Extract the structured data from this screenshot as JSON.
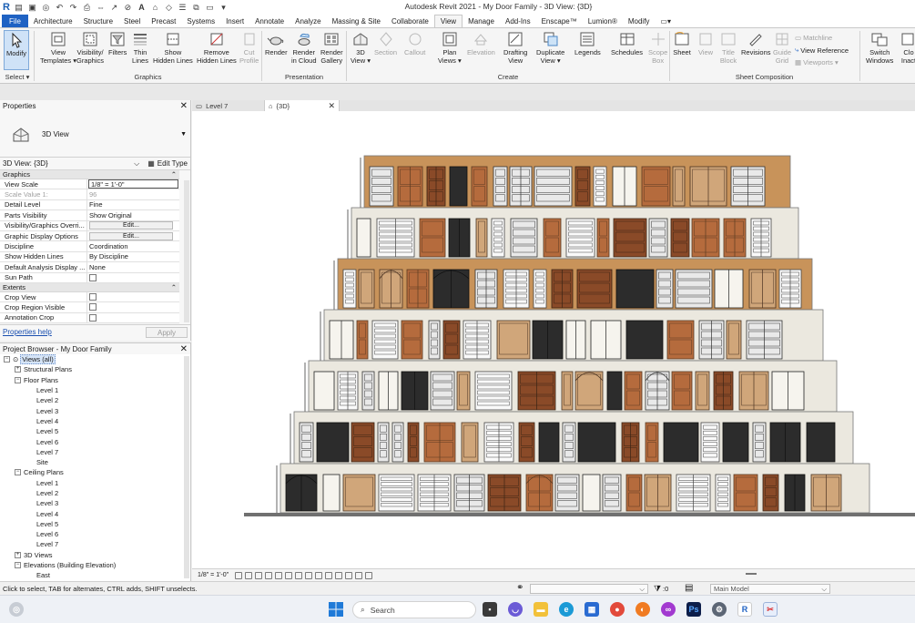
{
  "window": {
    "title": "Autodesk Revit 2021 - My Door Family - 3D View: {3D}",
    "app_icon": "R"
  },
  "qat": {
    "text_glyph": "A"
  },
  "ribbon_tabs": [
    "File",
    "Architecture",
    "Structure",
    "Steel",
    "Precast",
    "Systems",
    "Insert",
    "Annotate",
    "Analyze",
    "Massing & Site",
    "Collaborate",
    "View",
    "Manage",
    "Add-Ins",
    "Enscape™",
    "Lumion®",
    "Modify"
  ],
  "ribbon_active_tab": "View",
  "ribbon": {
    "modify": "Modify",
    "select": "Select ▾",
    "graphics_panel": "Graphics",
    "view_templates_1": "View",
    "view_templates_2": "Templates ▾",
    "visibility_1": "Visibility/",
    "visibility_2": "Graphics",
    "filters": "Filters",
    "thin_lines_1": "Thin",
    "thin_lines_2": "Lines",
    "show_hidden_1": "Show",
    "show_hidden_2": "Hidden Lines",
    "remove_hidden_1": "Remove",
    "remove_hidden_2": "Hidden Lines",
    "cut_profile_1": "Cut",
    "cut_profile_2": "Profile",
    "presentation_panel": "Presentation",
    "render": "Render",
    "render_cloud_1": "Render",
    "render_cloud_2": "in Cloud",
    "render_gallery_1": "Render",
    "render_gallery_2": "Gallery",
    "create_panel": "Create",
    "view3d_1": "3D",
    "view3d_2": "View ▾",
    "section": "Section",
    "callout": "Callout",
    "plan_views_1": "Plan",
    "plan_views_2": "Views ▾",
    "elevation": "Elevation",
    "drafting_1": "Drafting",
    "drafting_2": "View",
    "duplicate_1": "Duplicate",
    "duplicate_2": "View ▾",
    "legends": "Legends",
    "schedules": "Schedules",
    "scope_box_1": "Scope",
    "scope_box_2": "Box",
    "sheet_panel": "Sheet Composition",
    "sheet": "Sheet",
    "view": "View",
    "title_block_1": "Title",
    "title_block_2": "Block",
    "revisions": "Revisions",
    "guide_grid_1": "Guide",
    "guide_grid_2": "Grid",
    "matchline": "Matchline",
    "view_reference": "View  Reference",
    "viewports": "Viewports ▾",
    "switch_windows_1": "Switch",
    "switch_windows_2": "Windows",
    "close_inactive_1": "Clo",
    "close_inactive_2": "Inact"
  },
  "properties": {
    "title": "Properties",
    "type_name": "3D View",
    "instance_selector": "3D View: {3D}",
    "edit_type": "Edit Type",
    "sections": {
      "graphics": "Graphics",
      "extents": "Extents"
    },
    "graphics_rows": [
      {
        "key": "View Scale",
        "value": "1/8\" = 1'-0\""
      },
      {
        "key": "Scale Value    1:",
        "value": "96"
      },
      {
        "key": "Detail Level",
        "value": "Fine"
      },
      {
        "key": "Parts Visibility",
        "value": "Show Original"
      },
      {
        "key": "Visibility/Graphics Overri...",
        "value": "Edit..."
      },
      {
        "key": "Graphic Display Options",
        "value": "Edit..."
      },
      {
        "key": "Discipline",
        "value": "Coordination"
      },
      {
        "key": "Show Hidden Lines",
        "value": "By Discipline"
      },
      {
        "key": "Default Analysis Display ...",
        "value": "None"
      },
      {
        "key": "Sun Path",
        "value": ""
      }
    ],
    "extents_rows": [
      {
        "key": "Crop View"
      },
      {
        "key": "Crop Region Visible"
      },
      {
        "key": "Annotation Crop"
      }
    ],
    "help": "Properties help",
    "apply": "Apply"
  },
  "browser": {
    "title": "Project Browser - My Door Family",
    "nodes": [
      {
        "label": "Views (all)",
        "indent": 0,
        "twist": "−",
        "selected": true
      },
      {
        "label": "Structural Plans",
        "indent": 1,
        "twist": "+"
      },
      {
        "label": "Floor Plans",
        "indent": 1,
        "twist": "−"
      },
      {
        "label": "Level 1",
        "indent": 3
      },
      {
        "label": "Level 2",
        "indent": 3
      },
      {
        "label": "Level 3",
        "indent": 3
      },
      {
        "label": "Level 4",
        "indent": 3
      },
      {
        "label": "Level 5",
        "indent": 3
      },
      {
        "label": "Level 6",
        "indent": 3
      },
      {
        "label": "Level 7",
        "indent": 3
      },
      {
        "label": "Site",
        "indent": 3
      },
      {
        "label": "Ceiling Plans",
        "indent": 1,
        "twist": "−"
      },
      {
        "label": "Level 1",
        "indent": 3
      },
      {
        "label": "Level 2",
        "indent": 3
      },
      {
        "label": "Level 3",
        "indent": 3
      },
      {
        "label": "Level 4",
        "indent": 3
      },
      {
        "label": "Level 5",
        "indent": 3
      },
      {
        "label": "Level 6",
        "indent": 3
      },
      {
        "label": "Level 7",
        "indent": 3
      },
      {
        "label": "3D Views",
        "indent": 1,
        "twist": "+"
      },
      {
        "label": "Elevations (Building Elevation)",
        "indent": 1,
        "twist": "−"
      },
      {
        "label": "East",
        "indent": 3
      }
    ]
  },
  "view_tabs": [
    {
      "label": "Level 7",
      "active": false
    },
    {
      "label": "{3D}",
      "active": true
    }
  ],
  "view_control": {
    "scale": "1/8\" = 1'-0\""
  },
  "status": {
    "hint": "Click to select, TAB for alternates, CTRL adds, SHIFT unselects.",
    "filter_count": ":0",
    "model": "Main Model"
  },
  "taskbar": {
    "search": "Search"
  },
  "colors": {
    "accent": "#1f62c3",
    "wall_tan": "#c8935a",
    "wall_cream": "#ebe8df",
    "door_wood": "#b56b3d",
    "dark": "#2c2c2c"
  }
}
